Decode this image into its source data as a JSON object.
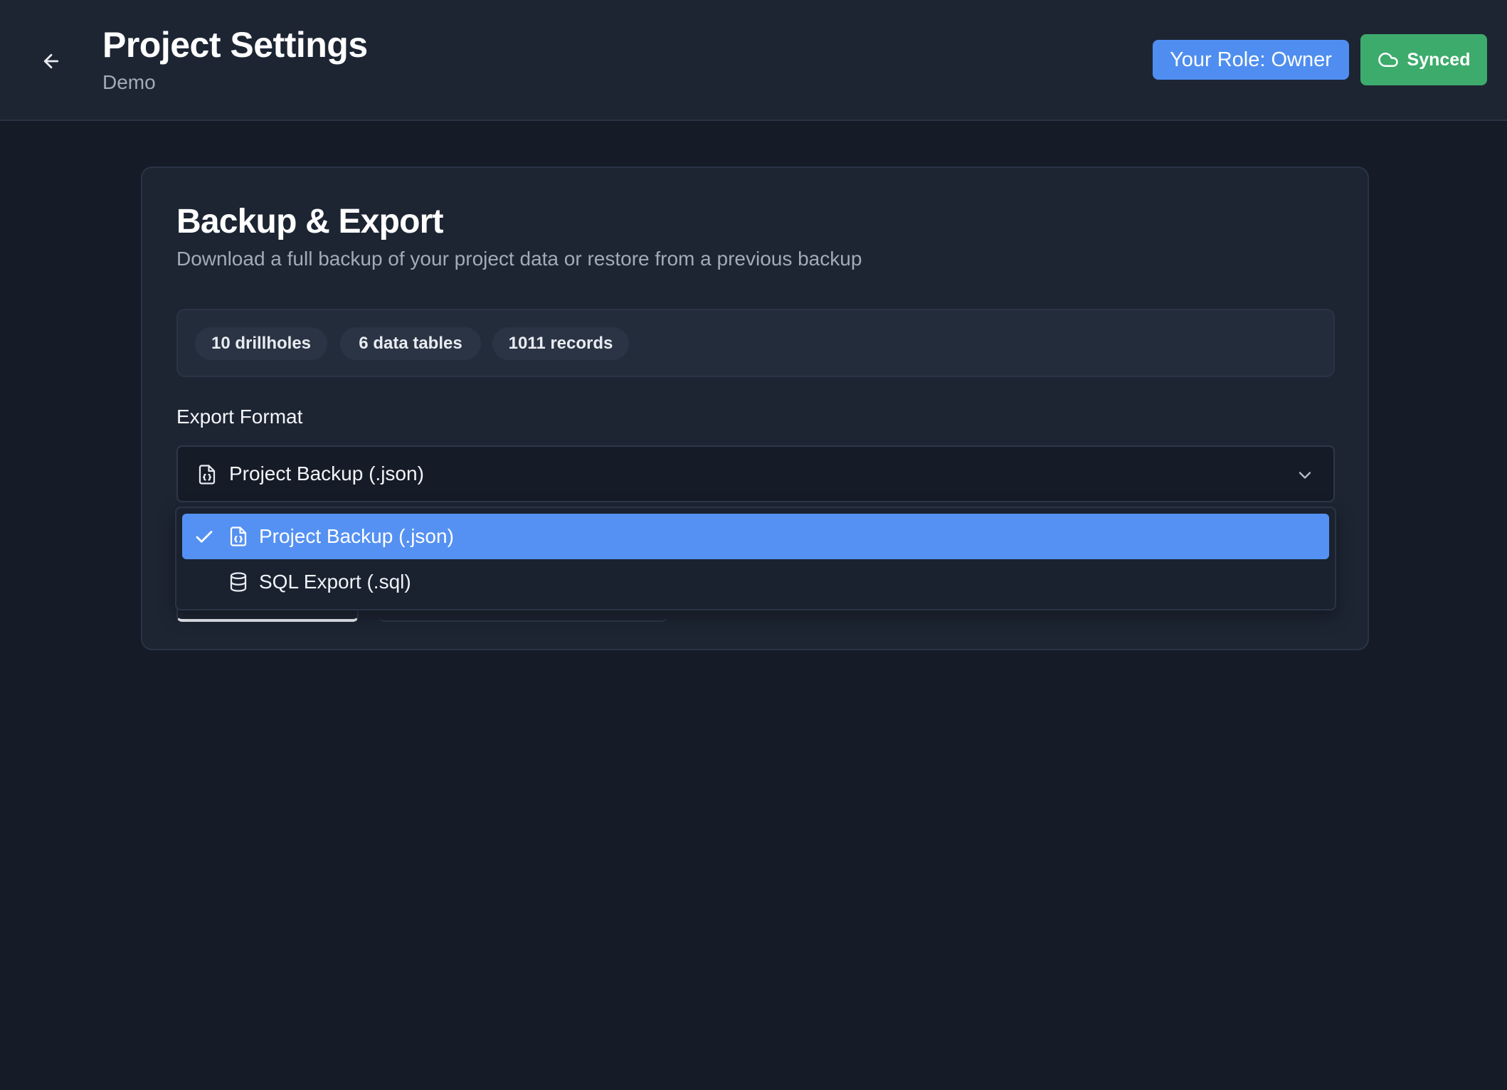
{
  "header": {
    "title": "Project Settings",
    "subtitle": "Demo",
    "back_icon": "arrow-left-icon",
    "role_label": "Your Role: Owner",
    "sync_label": "Synced",
    "sync_icon": "cloud-icon"
  },
  "card": {
    "title": "Backup & Export",
    "description": "Download a full backup of your project data or restore from a previous backup",
    "stats": [
      "10 drillholes",
      "6 data tables",
      "1011 records"
    ],
    "export_format_label": "Export Format",
    "select": {
      "value": "Project Backup (.json)",
      "icon": "file-json-icon"
    },
    "options": [
      {
        "label": "Project Backup (.json)",
        "icon": "file-json-icon",
        "selected": true
      },
      {
        "label": "SQL Export (.sql)",
        "icon": "database-icon",
        "selected": false
      }
    ]
  },
  "colors": {
    "background": "#151b27",
    "surface": "#1d2533",
    "accent_blue": "#4f8ef0",
    "selected_option": "#5591f2",
    "synced_green": "#3dab6c"
  }
}
